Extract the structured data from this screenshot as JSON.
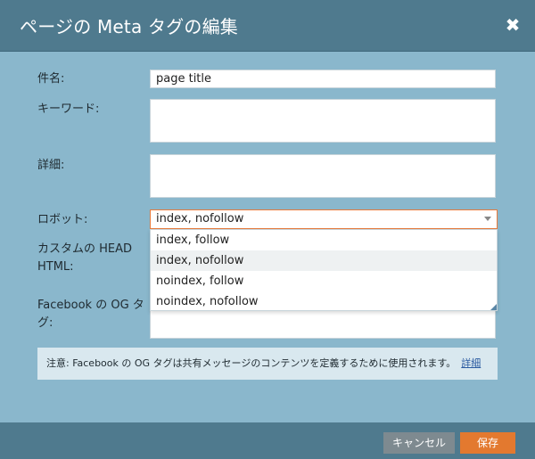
{
  "dialog": {
    "title": "ページの Meta タグの編集",
    "close_label": "✖"
  },
  "form": {
    "title_label": "件名:",
    "title_value": "page title",
    "keywords_label": "キーワード:",
    "keywords_value": "",
    "description_label": "詳細:",
    "description_value": "",
    "robots_label": "ロボット:",
    "robots_value": "index, nofollow",
    "robots_options": [
      "index, follow",
      "index, nofollow",
      "noindex, follow",
      "noindex, nofollow"
    ],
    "custom_head_label_line1": "カスタムの HEAD",
    "custom_head_label_line2": "HTML:",
    "og_label_line1": "Facebook の OG タ",
    "og_label_line2": "グ:",
    "og_value": ""
  },
  "note": {
    "text": "注意: Facebook の OG タグは共有メッセージのコンテンツを定義するために使用されます。",
    "link_label": "詳細"
  },
  "footer": {
    "cancel_label": "キャンセル",
    "save_label": "保存"
  },
  "colors": {
    "header_bg": "#4f7a8e",
    "body_bg": "#8ab7cc",
    "save_button": "#e3792f",
    "cancel_button": "#7e8a90",
    "select_border_focus": "#e87a3b"
  }
}
